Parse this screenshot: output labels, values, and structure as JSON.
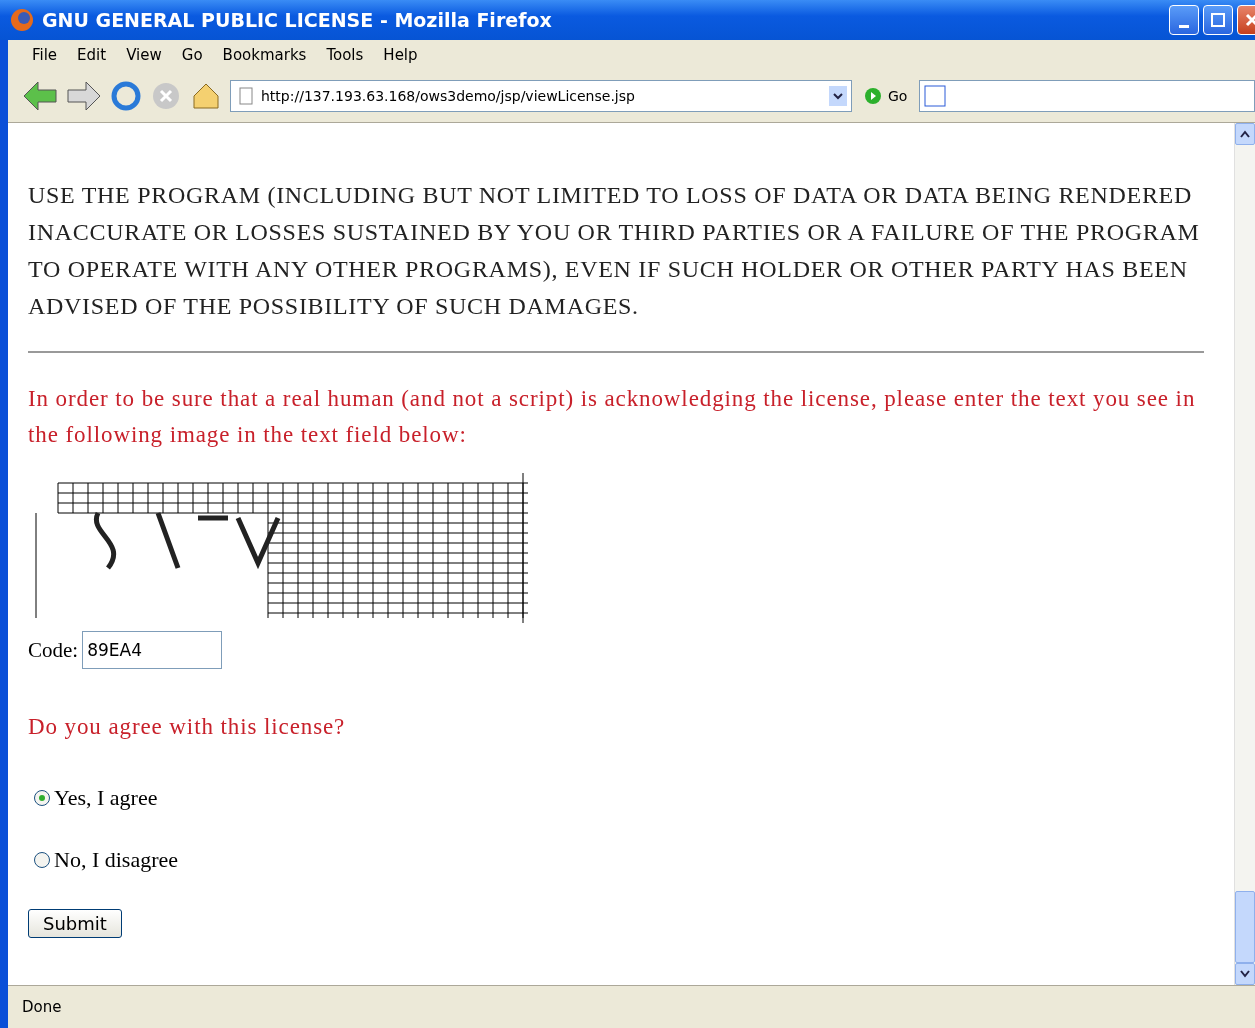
{
  "window": {
    "title": "GNU GENERAL PUBLIC LICENSE - Mozilla Firefox"
  },
  "menu": [
    "File",
    "Edit",
    "View",
    "Go",
    "Bookmarks",
    "Tools",
    "Help"
  ],
  "toolbar": {
    "url": "http://137.193.63.168/ows3demo/jsp/viewLicense.jsp",
    "go_label": "Go"
  },
  "page": {
    "license_text": "USE THE PROGRAM (INCLUDING BUT NOT LIMITED TO LOSS OF DATA OR DATA BEING RENDERED INACCURATE OR LOSSES SUSTAINED BY YOU OR THIRD PARTIES OR A FAILURE OF THE PROGRAM TO OPERATE WITH ANY OTHER PROGRAMS), EVEN IF SUCH HOLDER OR OTHER PARTY HAS BEEN ADVISED OF THE POSSIBILITY OF SUCH DAMAGES.",
    "instruction": "In order to be sure that a real human (and not a script) is acknowledging the license, please enter the text you see in the following image in the text field below:",
    "code_label": "Code:",
    "code_value": "89EA4",
    "question": "Do you agree with this license?",
    "options": [
      {
        "label": "Yes, I agree",
        "selected": true
      },
      {
        "label": "No, I disagree",
        "selected": false
      }
    ],
    "submit": "Submit"
  },
  "status_bar": "Done"
}
